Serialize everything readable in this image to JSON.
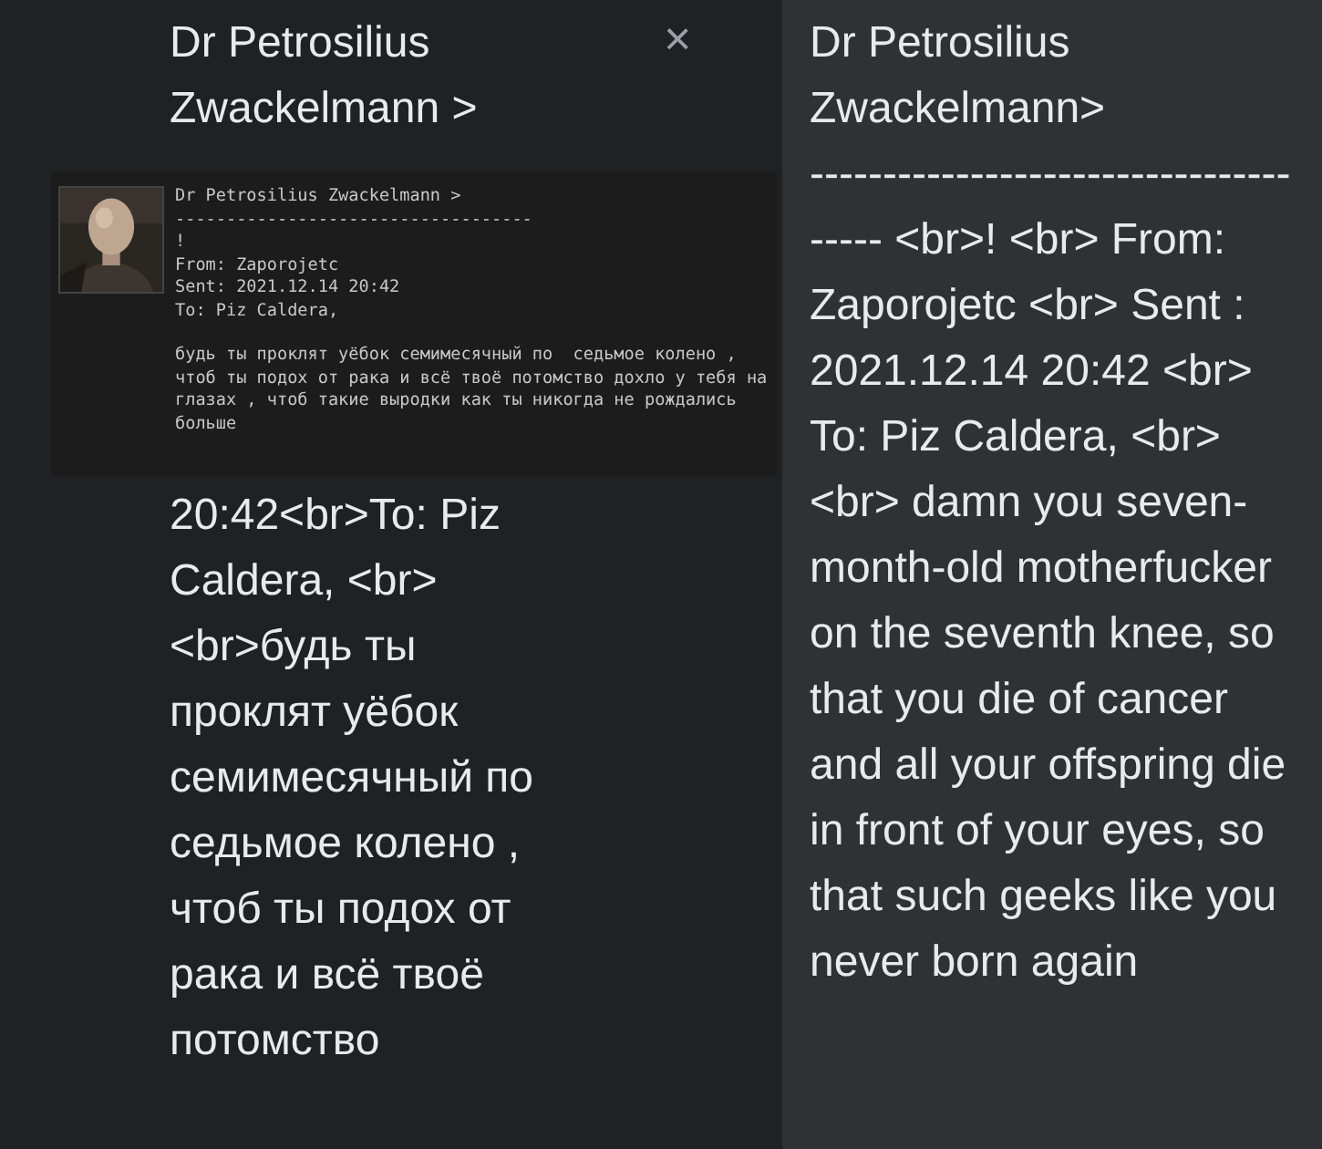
{
  "source": {
    "title": "Dr Petrosilius Zwackelmann >",
    "close": "×",
    "screenshot": {
      "lines": [
        "Dr Petrosilius Zwackelmann >",
        "-----------------------------------",
        "!",
        "From: Zaporojetc",
        "Sent: 2021.12.14 20:42",
        "To: Piz Caldera,"
      ],
      "message": "будь ты проклят уёбок семимесячный по  седьмое колено , чтоб ты подох от рака и всё твоё потомство дохло у тебя на глазах , чтоб такие выродки как ты никогда не рождались больше"
    },
    "text": "20:42<br>To: Piz Caldera, <br><br>будь ты проклят уёбок семимесячный по  седьмое колено , чтоб ты подох от рака и всё твоё потомство"
  },
  "translation": {
    "title": "Dr Petrosilius Zwackelmann>",
    "text": "-------------------------------------- <br>! <br> From: Zaporojetc <br> Sent : 2021.12.14 20:42 <br> To: Piz Caldera, <br> <br> damn you seven-month-old motherfucker on the seventh knee, so that you die of cancer and all your offspring die in front of your eyes, so that such geeks like you never born again"
  }
}
